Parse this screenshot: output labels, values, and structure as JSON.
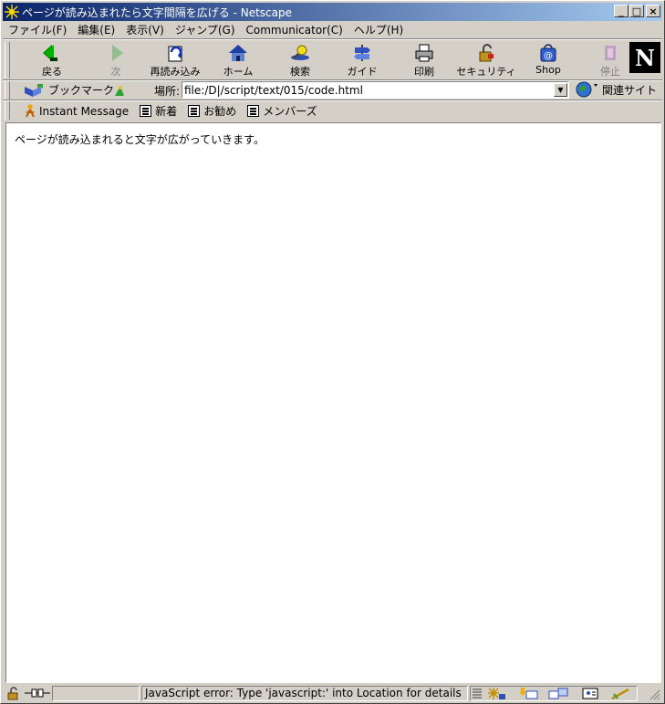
{
  "window": {
    "title": "ページが読み込まれたら文字間隔を広げる - Netscape",
    "minimize": "_",
    "maximize": "□",
    "close": "×"
  },
  "menu": [
    "ファイル(F)",
    "編集(E)",
    "表示(V)",
    "ジャンプ(G)",
    "Communicator(C)",
    "ヘルプ(H)"
  ],
  "nav": {
    "back": "戻る",
    "forward": "次",
    "reload": "再読み込み",
    "home": "ホーム",
    "search": "検索",
    "guide": "ガイド",
    "print": "印刷",
    "security": "セキュリティ",
    "shop": "Shop",
    "stop": "停止",
    "logo": "N"
  },
  "location": {
    "bookmarks": "ブックマーク",
    "label": "場所:",
    "url": "file:/D|/script/text/015/code.html",
    "related": "関連サイト"
  },
  "personal": {
    "instant_message": "Instant Message",
    "new": "新着",
    "recommend": "お勧め",
    "members": "メンバーズ"
  },
  "content": {
    "text": "ページが読み込まれると文字が広がっていきます。"
  },
  "status": {
    "message": "JavaScript error: Type 'javascript:' into Location for details"
  },
  "colors": {
    "title_start": "#0a246a",
    "title_end": "#a6caf0",
    "chrome": "#d4d0c8"
  }
}
